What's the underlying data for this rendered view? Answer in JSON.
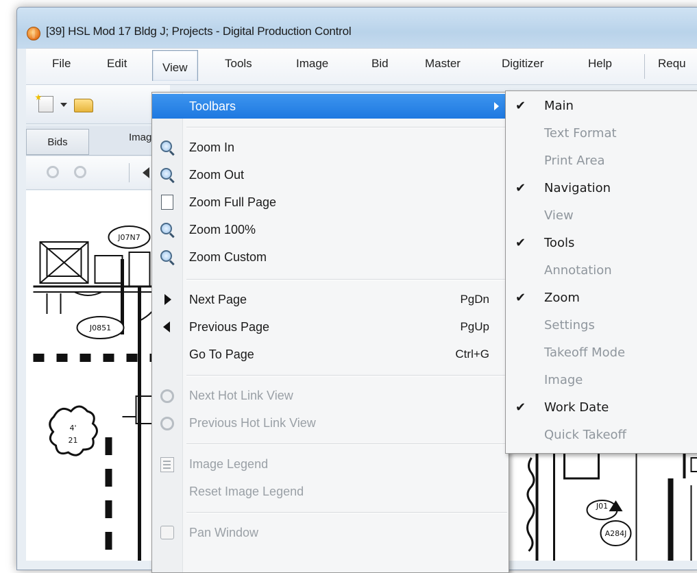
{
  "window": {
    "title": "[39] HSL Mod 17 Bldg J; Projects - Digital Production Control"
  },
  "menubar": {
    "items": [
      "File",
      "Edit",
      "View",
      "Tools",
      "Image",
      "Bid",
      "Master",
      "Digitizer",
      "Help",
      "Requ"
    ]
  },
  "tabs": {
    "bids": "Bids",
    "images": "Imag"
  },
  "drawing_labels": {
    "tag1": "J07N7",
    "tag2": "J0851",
    "tag3": "J01",
    "tag4": "A284J",
    "dim1": "4'",
    "dim2": "21"
  },
  "view_menu": {
    "items": [
      {
        "label": "Toolbars",
        "shortcut": "",
        "disabled": false
      },
      {
        "label": "Zoom In",
        "shortcut": "",
        "disabled": false
      },
      {
        "label": "Zoom Out",
        "shortcut": "",
        "disabled": false
      },
      {
        "label": "Zoom Full Page",
        "shortcut": "",
        "disabled": false
      },
      {
        "label": "Zoom 100%",
        "shortcut": "",
        "disabled": false
      },
      {
        "label": "Zoom Custom",
        "shortcut": "",
        "disabled": false
      },
      {
        "label": "Next Page",
        "shortcut": "PgDn",
        "disabled": false
      },
      {
        "label": "Previous Page",
        "shortcut": "PgUp",
        "disabled": false
      },
      {
        "label": "Go To Page",
        "shortcut": "Ctrl+G",
        "disabled": false
      },
      {
        "label": "Next Hot Link View",
        "shortcut": "",
        "disabled": true
      },
      {
        "label": "Previous Hot Link View",
        "shortcut": "",
        "disabled": true
      },
      {
        "label": "Image Legend",
        "shortcut": "",
        "disabled": true
      },
      {
        "label": "Reset Image Legend",
        "shortcut": "",
        "disabled": true
      },
      {
        "label": "Pan Window",
        "shortcut": "",
        "disabled": true
      }
    ]
  },
  "toolbars_submenu": {
    "items": [
      {
        "label": "Main",
        "checked": true,
        "disabled": false
      },
      {
        "label": "Text Format",
        "checked": false,
        "disabled": true
      },
      {
        "label": "Print Area",
        "checked": false,
        "disabled": true
      },
      {
        "label": "Navigation",
        "checked": true,
        "disabled": false
      },
      {
        "label": "View",
        "checked": false,
        "disabled": true
      },
      {
        "label": "Tools",
        "checked": true,
        "disabled": false
      },
      {
        "label": "Annotation",
        "checked": false,
        "disabled": true
      },
      {
        "label": "Zoom",
        "checked": true,
        "disabled": false
      },
      {
        "label": "Settings",
        "checked": false,
        "disabled": true
      },
      {
        "label": "Takeoff Mode",
        "checked": false,
        "disabled": true
      },
      {
        "label": "Image",
        "checked": false,
        "disabled": true
      },
      {
        "label": "Work Date",
        "checked": true,
        "disabled": false
      },
      {
        "label": "Quick Takeoff",
        "checked": false,
        "disabled": true
      }
    ],
    "check_glyph": "✔"
  },
  "colors": {
    "highlight": "#1e78e0",
    "disabled_text": "#9aa0a6"
  }
}
